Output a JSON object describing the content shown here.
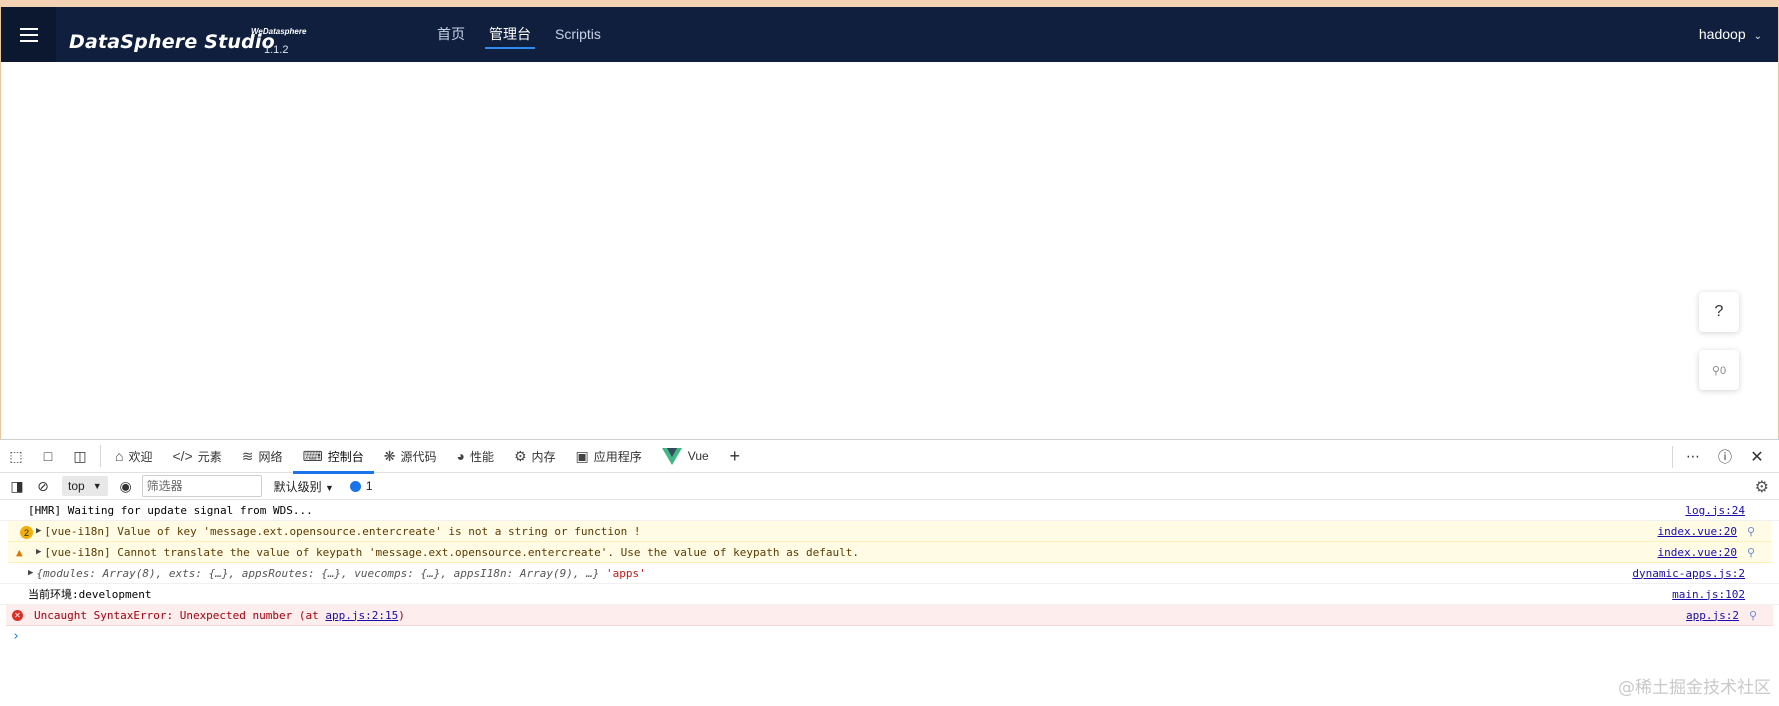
{
  "app": {
    "logo": {
      "title": "DataSphere Studio",
      "brand": "WeDatasphere",
      "version": "1.1.2"
    },
    "nav": [
      {
        "label": "首页",
        "active": false
      },
      {
        "label": "管理台",
        "active": true
      },
      {
        "label": "Scriptis",
        "active": false
      }
    ],
    "user": {
      "name": "hadoop"
    },
    "float_help": "?",
    "float_code": "⚲0"
  },
  "devtools": {
    "tabs": [
      {
        "label": "欢迎",
        "icon": "home-icon"
      },
      {
        "label": "元素",
        "icon": "code-icon"
      },
      {
        "label": "网络",
        "icon": "wifi-icon"
      },
      {
        "label": "控制台",
        "icon": "console-icon",
        "active": true
      },
      {
        "label": "源代码",
        "icon": "bug-icon"
      },
      {
        "label": "性能",
        "icon": "gauge-icon"
      },
      {
        "label": "内存",
        "icon": "chip-icon"
      },
      {
        "label": "应用程序",
        "icon": "window-icon"
      },
      {
        "label": "Vue",
        "icon": "vue-icon"
      }
    ],
    "filter": {
      "context": "top",
      "placeholder": "筛选器",
      "level": "默认级别",
      "message_count": "1"
    },
    "messages": [
      {
        "type": "log",
        "text": "[HMR] Waiting for update signal from WDS...",
        "source": "log.js:24"
      },
      {
        "type": "warn",
        "count": "2",
        "text": "[vue-i18n] Value of key 'message.ext.opensource.entercreate' is not a string or function !",
        "source": "index.vue:20"
      },
      {
        "type": "warn",
        "text": "[vue-i18n] Cannot translate the value of keypath 'message.ext.opensource.entercreate'. Use the value of keypath as default.",
        "source": "index.vue:20"
      },
      {
        "type": "object",
        "text": "{modules: Array(8), exts: {…}, appsRoutes: {…}, vuecomps: {…}, appsI18n: Array(9), …}",
        "extra": "'apps'",
        "source": "dynamic-apps.js:2"
      },
      {
        "type": "log",
        "text": "当前环境:development",
        "source": "main.js:102"
      },
      {
        "type": "error",
        "text": "Uncaught SyntaxError: Unexpected number (at ",
        "link": "app.js:2:15",
        "tail": ")",
        "source": "app.js:2"
      }
    ]
  },
  "watermark": "@稀土掘金技术社区",
  "colors": {
    "topbar": "#0f1f3d",
    "accent": "#2d8cf0",
    "console_tab_underline": "#1a73e8"
  }
}
